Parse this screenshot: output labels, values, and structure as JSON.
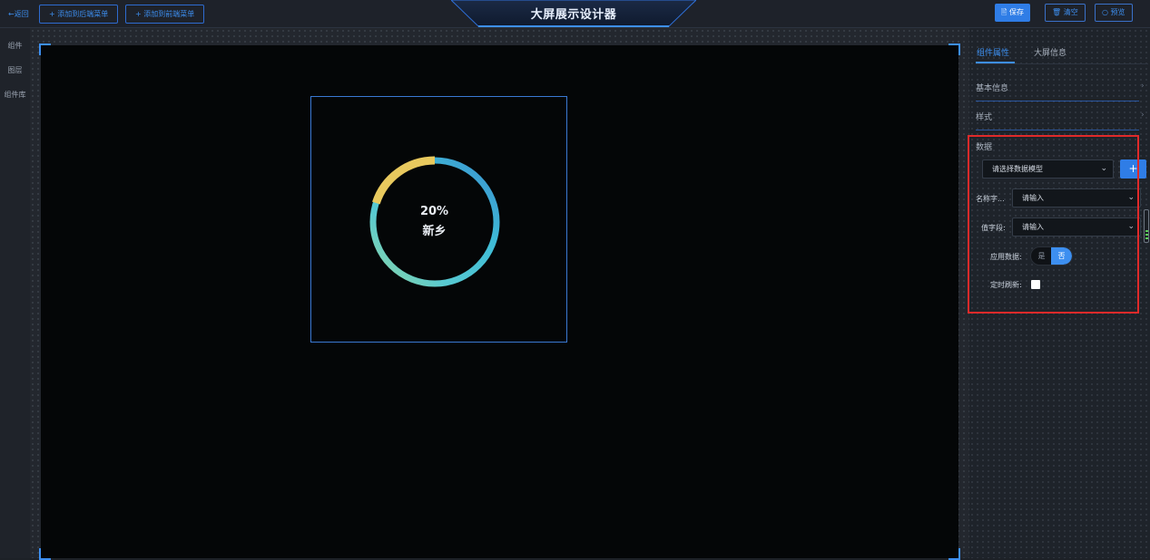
{
  "topbar": {
    "back_label": "←返回",
    "add_backend_menu": "+ 添加到后端菜单",
    "add_frontend_menu": "+ 添加到前端菜单",
    "title": "大屏展示设计器",
    "save_label": "🖹 保存",
    "clear_label": "🗑 清空",
    "preview_label": "○ 预览"
  },
  "leftnav": {
    "items": [
      "组件",
      "图层",
      "组件库"
    ]
  },
  "widget": {
    "percent": "20%",
    "name": "新乡",
    "value_fraction": 0.2
  },
  "rightpanel": {
    "tabs": [
      "组件属性",
      "大屏信息"
    ],
    "sections": {
      "basic": "基本信息",
      "style": "样式",
      "data": "数据"
    },
    "data_model_select": "请选择数据模型",
    "plus_label": "+",
    "name_field_label": "名称字...",
    "name_field_value": "请输入",
    "value_field_label": "值字段:",
    "value_field_value": "请输入",
    "apply_data_label": "应用数据:",
    "apply_yes": "是",
    "apply_no": "否",
    "timed_refresh_label": "定时刷新:"
  },
  "colors": {
    "accent": "#3d8ff0",
    "primary_button": "#2f7de6",
    "highlight_box": "#e02a2a",
    "ring_yellow": "#e8c95e",
    "ring_cyan": "#3fbcd6",
    "ring_teal": "#66d2c3"
  }
}
